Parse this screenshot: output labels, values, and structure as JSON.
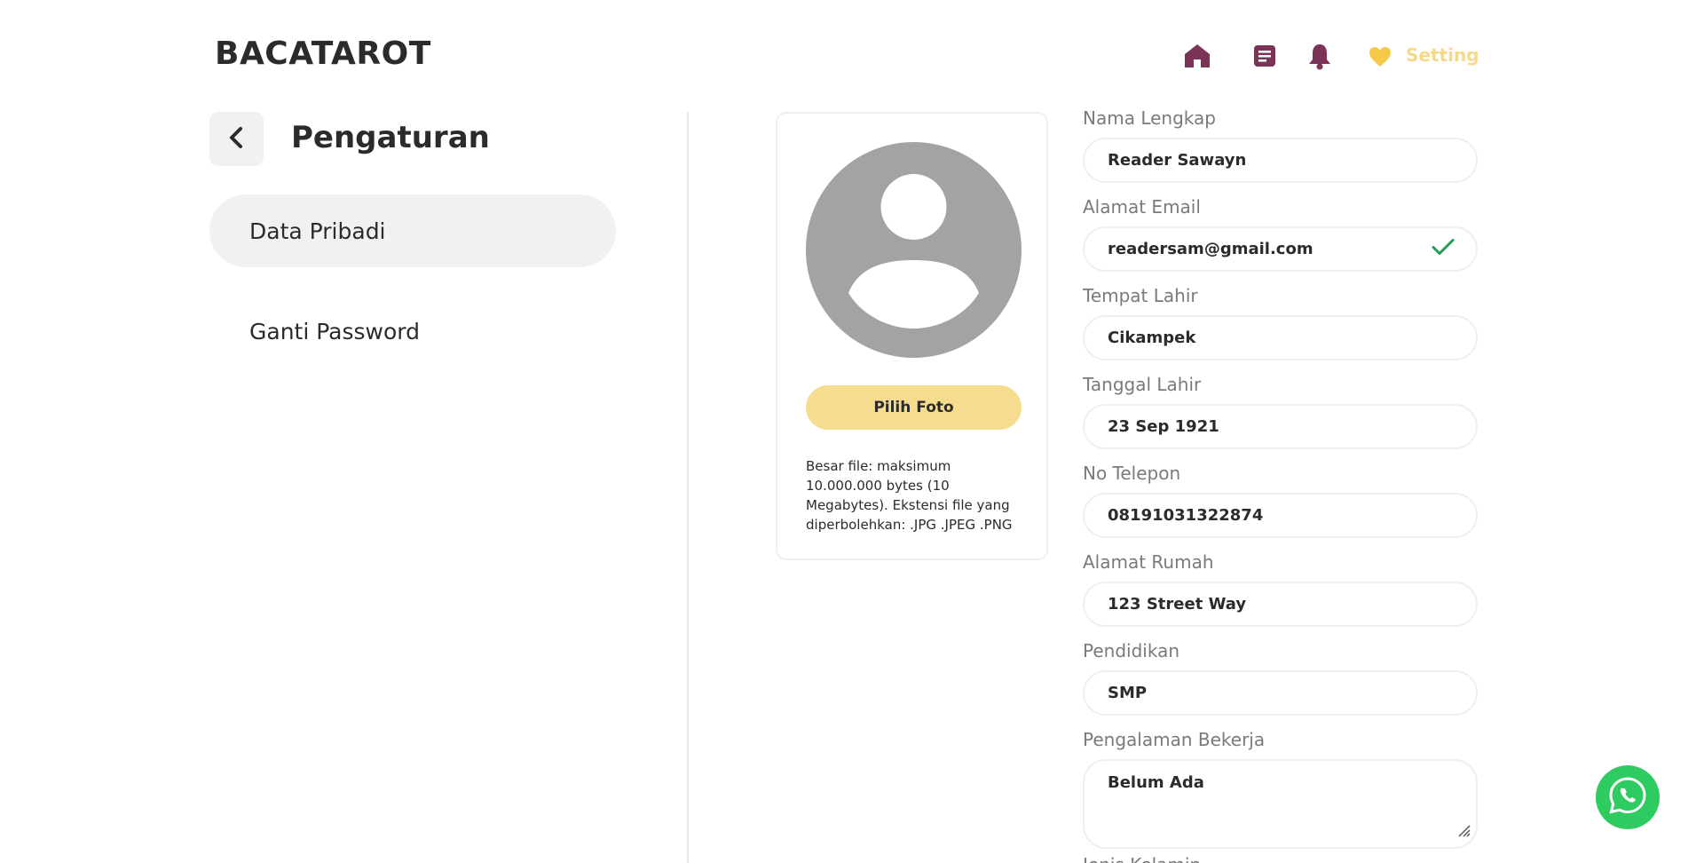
{
  "header": {
    "logo": "BACATAROT",
    "nav": {
      "setting_label": "Setting"
    }
  },
  "sidebar": {
    "title": "Pengaturan",
    "items": [
      {
        "label": "Data Pribadi",
        "active": true
      },
      {
        "label": "Ganti Password",
        "active": false
      }
    ]
  },
  "photo": {
    "button_label": "Pilih Foto",
    "note": "Besar file: maksimum 10.000.000 bytes (10 Megabytes). Ekstensi file yang diperbolehkan: .JPG .JPEG .PNG"
  },
  "form": {
    "fields": [
      {
        "label": "Nama Lengkap",
        "value": "Reader Sawayn"
      },
      {
        "label": "Alamat Email",
        "value": "readersam@gmail.com",
        "verified": true
      },
      {
        "label": "Tempat Lahir",
        "value": "Cikampek"
      },
      {
        "label": "Tanggal Lahir",
        "value": "23 Sep 1921"
      },
      {
        "label": "No Telepon",
        "value": "08191031322874"
      },
      {
        "label": "Alamat Rumah",
        "value": "123 Street Way"
      },
      {
        "label": "Pendidikan",
        "value": "SMP"
      },
      {
        "label": "Pengalaman Bekerja",
        "value": "Belum Ada"
      },
      {
        "label": "Jenis Kelamin",
        "value": ""
      }
    ]
  },
  "colors": {
    "accent_yellow": "#f5dc8e",
    "nav_icon": "#7b3358",
    "heart": "#f7c948",
    "whatsapp": "#2ecc60",
    "check": "#1f9d55"
  },
  "icons": [
    "home-icon",
    "article-icon",
    "bell-icon",
    "heart-icon",
    "back-arrow-icon",
    "avatar-placeholder-icon",
    "check-icon",
    "resize-handle-icon",
    "whatsapp-icon"
  ]
}
